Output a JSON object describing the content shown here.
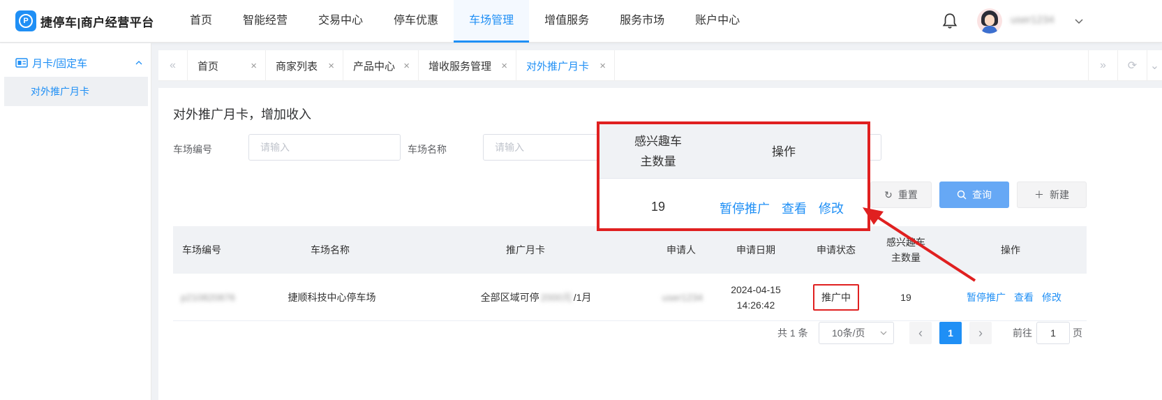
{
  "app": {
    "logo_text": "捷停车|商户经营平台",
    "logo_glyph": "P",
    "username": "user1234",
    "accent_color": "#1f8ff5",
    "highlight_color": "#e02020"
  },
  "nav": {
    "items": [
      "首页",
      "智能经营",
      "交易中心",
      "停车优惠",
      "车场管理",
      "增值服务",
      "服务市场",
      "账户中心"
    ],
    "active": "车场管理"
  },
  "sidebar": {
    "group_label": "月卡/固定车",
    "item_label": "对外推广月卡"
  },
  "tabs": {
    "items": [
      {
        "label": "首页",
        "close": "×"
      },
      {
        "label": "商家列表",
        "close": "×"
      },
      {
        "label": "产品中心",
        "close": "×"
      },
      {
        "label": "增收服务管理",
        "close": "×"
      },
      {
        "label": "对外推广月卡",
        "close": "×"
      }
    ],
    "active": "对外推广月卡"
  },
  "page": {
    "title": "对外推广月卡，增加收入"
  },
  "filters": {
    "lot_no_label": "车场编号",
    "lot_no_placeholder": "请输入",
    "lot_name_label": "车场名称",
    "lot_name_placeholder": "请输入"
  },
  "buttons": {
    "reset": "重置",
    "query": "查询",
    "new": "新建"
  },
  "table": {
    "headers": {
      "lot_no": "车场编号",
      "lot_name": "车场名称",
      "card": "推广月卡",
      "applicant": "申请人",
      "date": "申请日期",
      "status": "申请状态",
      "interested_line1": "感兴趣车",
      "interested_line2": "主数量",
      "actions": "操作"
    },
    "row": {
      "lot_no": "p210820876",
      "lot_name": "捷顺科技中心停车场",
      "card_prefix": "全部区域可停",
      "card_blur": "2000元",
      "card_suffix": "/1月",
      "applicant": "user1234",
      "date_line1": "2024-04-15",
      "date_line2": "14:26:42",
      "status": "推广中",
      "interested": "19",
      "action_pause": "暂停推广",
      "action_view": "查看",
      "action_edit": "修改"
    }
  },
  "pagination": {
    "total": "共 1 条",
    "page_size": "10条/页",
    "prev": "‹",
    "current": "1",
    "next": "›",
    "goto_label": "前往",
    "goto_value": "1",
    "page_suffix": "页"
  },
  "callout": {
    "header_interested_line1": "感兴趣车",
    "header_interested_line2": "主数量",
    "header_actions": "操作",
    "value": "19",
    "action_pause": "暂停推广",
    "action_view": "查看",
    "action_edit": "修改"
  }
}
